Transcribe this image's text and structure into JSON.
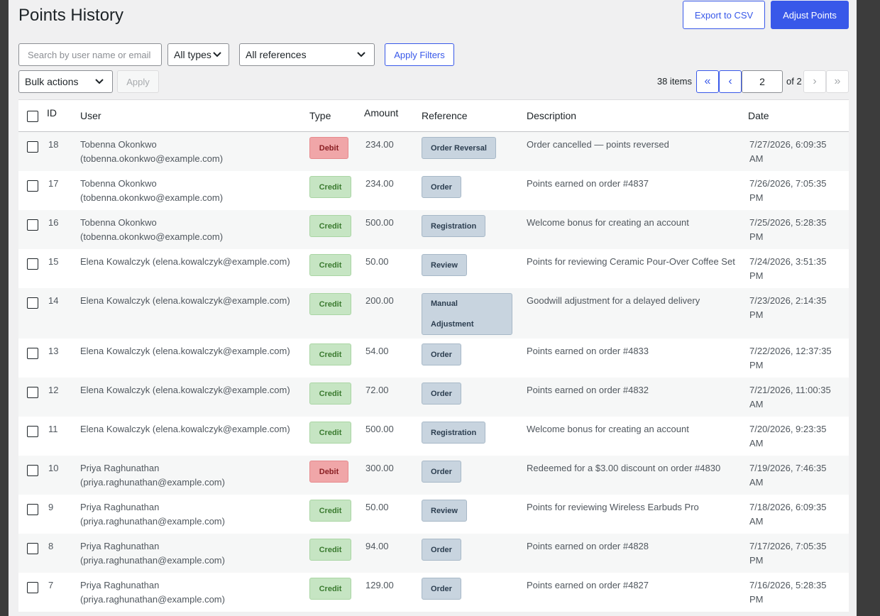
{
  "header": {
    "title": "Points History",
    "export_label": "Export to CSV",
    "adjust_label": "Adjust Points"
  },
  "filters": {
    "search_placeholder": "Search by user name or email",
    "type_value": "All types",
    "reference_value": "All references",
    "apply_filters_label": "Apply Filters"
  },
  "bulk": {
    "value": "Bulk actions",
    "apply_label": "Apply"
  },
  "pagination": {
    "items_text": "38 items",
    "first": "«",
    "prev": "‹",
    "current_page": "2",
    "of_text": "of 2",
    "next": "›",
    "last": "»"
  },
  "table": {
    "columns": {
      "id": "ID",
      "user": "User",
      "type": "Type",
      "amount": "Amount",
      "reference": "Reference",
      "description": "Description",
      "date": "Date"
    },
    "rows": [
      {
        "id": "18",
        "user1": "Tobenna Okonkwo",
        "user2": "(tobenna.okonkwo@example.com)",
        "type": "Debit",
        "amount": "234.00",
        "ref": "Order Reversal",
        "desc": "Order cancelled — points reversed",
        "date1": "7/27/2026, 6:09:35",
        "date2": "AM"
      },
      {
        "id": "17",
        "user1": "Tobenna Okonkwo",
        "user2": "(tobenna.okonkwo@example.com)",
        "type": "Credit",
        "amount": "234.00",
        "ref": "Order",
        "desc": "Points earned on order #4837",
        "date1": "7/26/2026, 7:05:35",
        "date2": "PM"
      },
      {
        "id": "16",
        "user1": "Tobenna Okonkwo",
        "user2": "(tobenna.okonkwo@example.com)",
        "type": "Credit",
        "amount": "500.00",
        "ref": "Registration",
        "desc": "Welcome bonus for creating an account",
        "date1": "7/25/2026, 5:28:35",
        "date2": "PM"
      },
      {
        "id": "15",
        "user1": "Elena Kowalczyk (elena.kowalczyk@example.com)",
        "user2": "",
        "type": "Credit",
        "amount": "50.00",
        "ref": "Review",
        "desc": "Points for reviewing Ceramic Pour-Over Coffee Set",
        "date1": "7/24/2026, 3:51:35",
        "date2": "PM"
      },
      {
        "id": "14",
        "user1": "Elena Kowalczyk (elena.kowalczyk@example.com)",
        "user2": "",
        "type": "Credit",
        "amount": "200.00",
        "ref1": "Manual",
        "ref2": "Adjustment",
        "desc": "Goodwill adjustment for a delayed delivery",
        "date1": "7/23/2026, 2:14:35",
        "date2": "PM"
      },
      {
        "id": "13",
        "user1": "Elena Kowalczyk (elena.kowalczyk@example.com)",
        "user2": "",
        "type": "Credit",
        "amount": "54.00",
        "ref": "Order",
        "desc": "Points earned on order #4833",
        "date1": "7/22/2026, 12:37:35",
        "date2": "PM"
      },
      {
        "id": "12",
        "user1": "Elena Kowalczyk (elena.kowalczyk@example.com)",
        "user2": "",
        "type": "Credit",
        "amount": "72.00",
        "ref": "Order",
        "desc": "Points earned on order #4832",
        "date1": "7/21/2026, 11:00:35",
        "date2": "AM"
      },
      {
        "id": "11",
        "user1": "Elena Kowalczyk (elena.kowalczyk@example.com)",
        "user2": "",
        "type": "Credit",
        "amount": "500.00",
        "ref": "Registration",
        "desc": "Welcome bonus for creating an account",
        "date1": "7/20/2026, 9:23:35",
        "date2": "AM"
      },
      {
        "id": "10",
        "user1": "Priya Raghunathan",
        "user2": "(priya.raghunathan@example.com)",
        "type": "Debit",
        "amount": "300.00",
        "ref": "Order",
        "desc": "Redeemed for a $3.00 discount on order #4830",
        "date1": "7/19/2026, 7:46:35",
        "date2": "AM"
      },
      {
        "id": "9",
        "user1": "Priya Raghunathan",
        "user2": "(priya.raghunathan@example.com)",
        "type": "Credit",
        "amount": "50.00",
        "ref": "Review",
        "desc": "Points for reviewing Wireless Earbuds Pro",
        "date1": "7/18/2026, 6:09:35",
        "date2": "AM"
      },
      {
        "id": "8",
        "user1": "Priya Raghunathan",
        "user2": "(priya.raghunathan@example.com)",
        "type": "Credit",
        "amount": "94.00",
        "ref": "Order",
        "desc": "Points earned on order #4828",
        "date1": "7/17/2026, 7:05:35",
        "date2": "PM"
      },
      {
        "id": "7",
        "user1": "Priya Raghunathan",
        "user2": "(priya.raghunathan@example.com)",
        "type": "Credit",
        "amount": "129.00",
        "ref": "Order",
        "desc": "Points earned on order #4827",
        "date1": "7/16/2026, 5:28:35",
        "date2": "PM"
      }
    ]
  },
  "colors": {
    "accent": "#3858e9",
    "debit_bg": "#f0a6a8",
    "credit_bg": "#c6e5c3",
    "reference_bg": "#c8d4df"
  }
}
